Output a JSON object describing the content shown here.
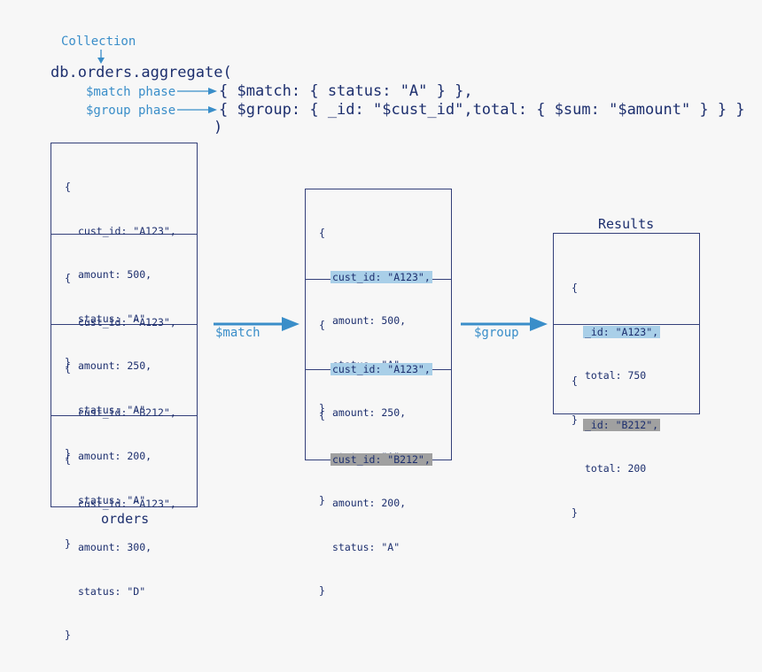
{
  "annotations": {
    "collection": "Collection",
    "match_phase": "$match phase",
    "group_phase": "$group phase"
  },
  "code": {
    "line1": "db.orders.aggregate(",
    "line2": "{ $match: { status: \"A\" } },",
    "line3": "{ $group: { _id: \"$cust_id\",total: { $sum: \"$amount\" } } }",
    "line4": ")"
  },
  "orders": {
    "caption": "orders",
    "documents": [
      {
        "open": "{",
        "cust_id": "cust_id: \"A123\",",
        "amount": "amount: 500,",
        "status": "status: \"A\"",
        "close": "}"
      },
      {
        "open": "{",
        "cust_id": "cust_id: \"A123\",",
        "amount": "amount: 250,",
        "status": "status: \"A\"",
        "close": "}"
      },
      {
        "open": "{",
        "cust_id": "cust_id: \"B212\",",
        "amount": "amount: 200,",
        "status": "status: \"A\"",
        "close": "}"
      },
      {
        "open": "{",
        "cust_id": "cust_id: \"A123\",",
        "amount": "amount: 300,",
        "status": "status: \"D\"",
        "close": "}"
      }
    ]
  },
  "stages": {
    "match_label": "$match",
    "group_label": "$group"
  },
  "matched": {
    "documents": [
      {
        "open": "{",
        "cust_id": "cust_id: \"A123\",",
        "amount": "amount: 500,",
        "status": "status: \"A\"",
        "close": "}",
        "highlight": "blue"
      },
      {
        "open": "{",
        "cust_id": "cust_id: \"A123\",",
        "amount": "amount: 250,",
        "status": "status: \"A\"",
        "close": "}",
        "highlight": "blue"
      },
      {
        "open": "{",
        "cust_id": "cust_id: \"B212\",",
        "amount": "amount: 200,",
        "status": "status: \"A\"",
        "close": "}",
        "highlight": "gray"
      }
    ]
  },
  "results": {
    "title": "Results",
    "documents": [
      {
        "open": "{",
        "id": "_id: \"A123\",",
        "total": "total: 750",
        "close": "}",
        "highlight": "blue"
      },
      {
        "open": "{",
        "id": "_id: \"B212\",",
        "total": "total: 200",
        "close": "}",
        "highlight": "gray"
      }
    ]
  },
  "colors": {
    "accent_blue": "#3a8ec9",
    "navy": "#1d2f6e",
    "highlight_blue": "#a9cfe8",
    "highlight_gray": "#a0a0a0",
    "background": "#f7f7f7"
  }
}
